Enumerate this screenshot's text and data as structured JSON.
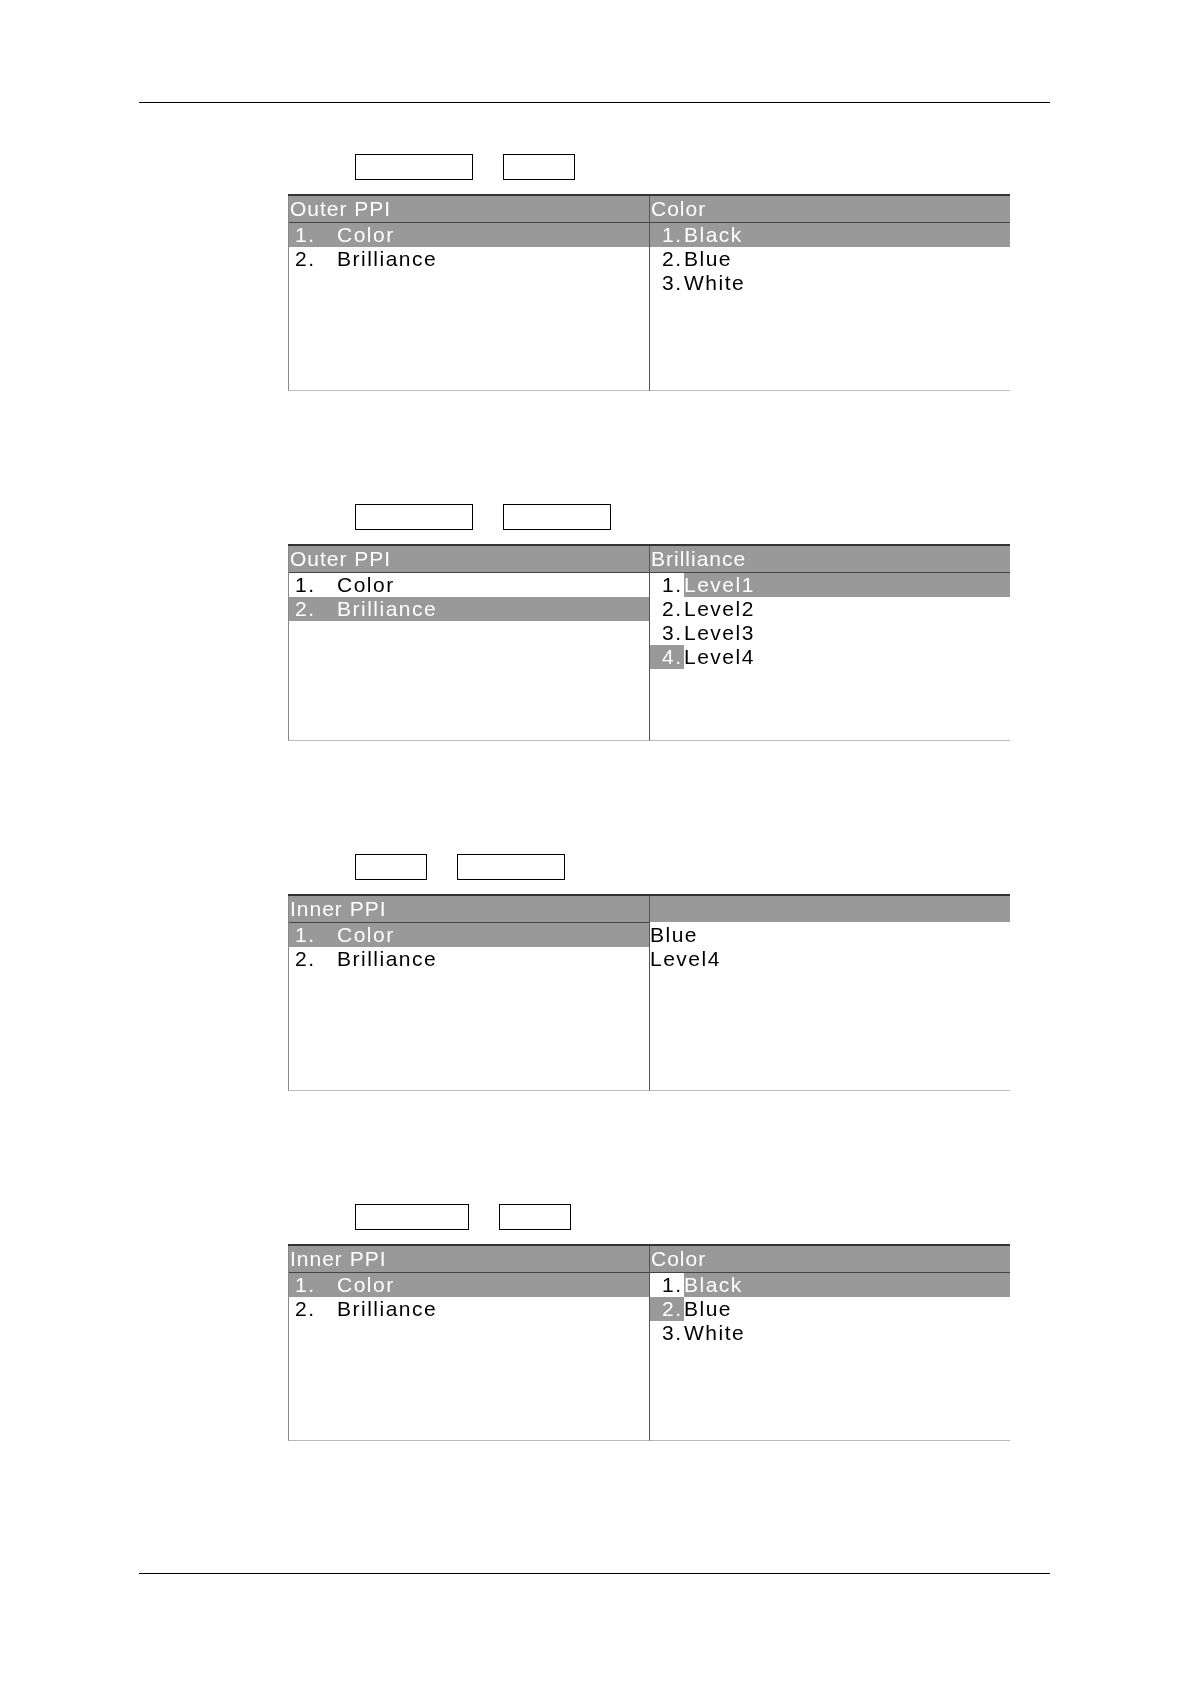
{
  "panels": [
    {
      "title": "Outer PPI",
      "items": [
        {
          "number": "1.",
          "label": "Color",
          "selected": true
        },
        {
          "number": "2.",
          "label": "Brilliance",
          "selected": false
        }
      ],
      "side": {
        "kind": "submenu",
        "title": "Color",
        "items": [
          {
            "number": "1.",
            "label": "Black",
            "selected": true,
            "current": true
          },
          {
            "number": "2.",
            "label": "Blue",
            "selected": false,
            "current": false
          },
          {
            "number": "3.",
            "label": "White",
            "selected": false,
            "current": false
          }
        ]
      }
    },
    {
      "title": "Outer PPI",
      "items": [
        {
          "number": "1.",
          "label": "Color",
          "selected": false
        },
        {
          "number": "2.",
          "label": "Brilliance",
          "selected": true
        }
      ],
      "side": {
        "kind": "submenu",
        "title": "Brilliance",
        "items": [
          {
            "number": "1.",
            "label": "Level1",
            "selected": true,
            "current": false
          },
          {
            "number": "2.",
            "label": "Level2",
            "selected": false,
            "current": false
          },
          {
            "number": "3.",
            "label": "Level3",
            "selected": false,
            "current": false
          },
          {
            "number": "4.",
            "label": "Level4",
            "selected": false,
            "current": true
          }
        ]
      }
    },
    {
      "title": "Inner PPI",
      "items": [
        {
          "number": "1.",
          "label": "Color",
          "selected": true
        },
        {
          "number": "2.",
          "label": "Brilliance",
          "selected": false
        }
      ],
      "side": {
        "kind": "values",
        "values": [
          "Blue",
          "Level4"
        ]
      }
    },
    {
      "title": "Inner PPI",
      "items": [
        {
          "number": "1.",
          "label": "Color",
          "selected": true
        },
        {
          "number": "2.",
          "label": "Brilliance",
          "selected": false
        }
      ],
      "side": {
        "kind": "submenu",
        "title": "Color",
        "items": [
          {
            "number": "1.",
            "label": "Black",
            "selected": true,
            "current": false
          },
          {
            "number": "2.",
            "label": "Blue",
            "selected": false,
            "current": true
          },
          {
            "number": "3.",
            "label": "White",
            "selected": false,
            "current": false
          }
        ]
      }
    }
  ]
}
